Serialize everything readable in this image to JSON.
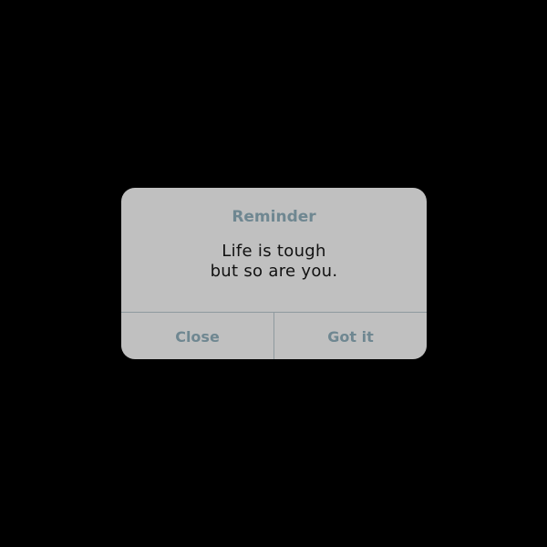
{
  "dialog": {
    "title": "Reminder",
    "message_line1": "Life is tough",
    "message_line2": "but so are you.",
    "buttons": [
      {
        "label": "Close"
      },
      {
        "label": "Got it"
      }
    ]
  },
  "colors": {
    "background": "#000000",
    "dialog": "#c0c0c0",
    "accent": "#6f8791",
    "text": "#111111"
  }
}
